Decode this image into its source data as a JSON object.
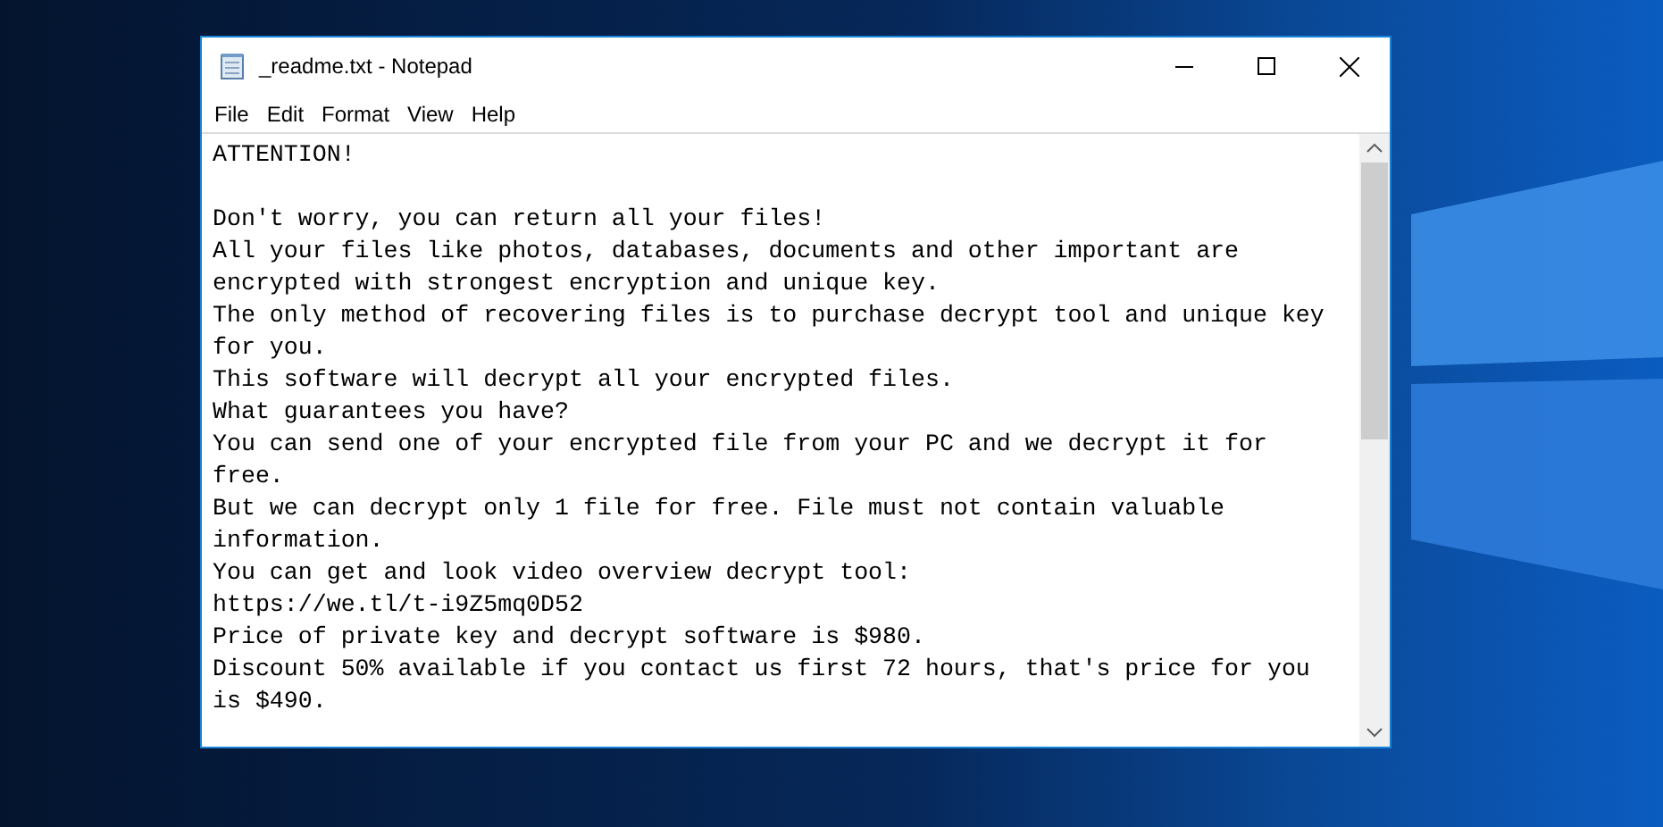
{
  "window": {
    "title": "_readme.txt - Notepad"
  },
  "menu": [
    "File",
    "Edit",
    "Format",
    "View",
    "Help"
  ],
  "document": {
    "heading": "ATTENTION!",
    "lines": [
      "Don't worry, you can return all your files!",
      "All your files like photos, databases, documents and other important are",
      "encrypted with strongest encryption and unique key.",
      "The only method of recovering files is to purchase decrypt tool and unique key",
      "for you.",
      "This software will decrypt all your encrypted files.",
      "What guarantees you have?",
      "You can send one of your encrypted file from your PC and we decrypt it for",
      "free.",
      "But we can decrypt only 1 file for free. File must not contain valuable",
      "information.",
      "You can get and look video overview decrypt tool:",
      "https://we.tl/t-i9Z5mq0D52",
      "Price of private key and decrypt software is $980.",
      "Discount 50% available if you contact us first 72 hours, that's price for you",
      "is $490."
    ]
  }
}
